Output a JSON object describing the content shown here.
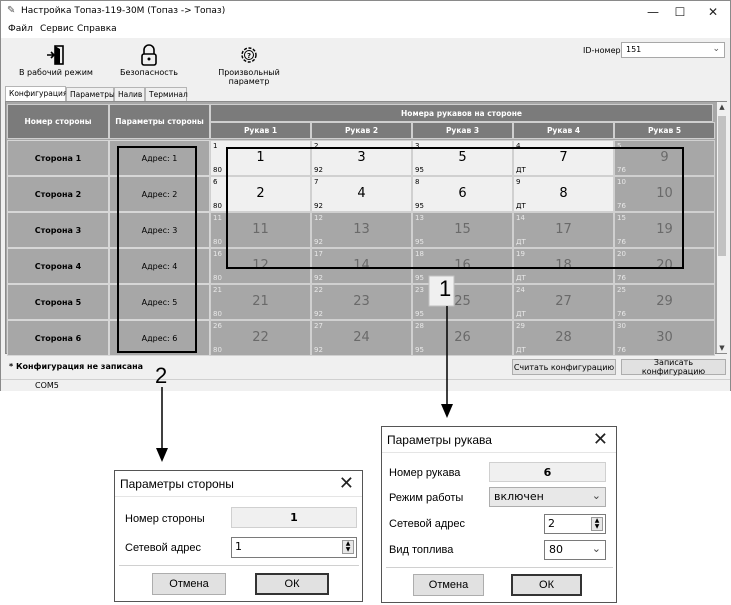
{
  "window": {
    "title": "Настройка Топаз-119-30М (Топаз -> Топаз)",
    "controls": [
      "—",
      "☐",
      "✕"
    ]
  },
  "menu": [
    "Файл",
    "Сервис",
    "Справка"
  ],
  "toolbar": {
    "work_mode": "В рабочий режим",
    "security": "Безопасность",
    "custom_param": "Произвольный параметр",
    "id_label": "ID-номер",
    "id_value": "151"
  },
  "tabs": [
    "Конфигурация",
    "Параметры",
    "Налив",
    "Терминал"
  ],
  "grid": {
    "col_side_number": "Номер стороны",
    "col_side_params": "Параметры стороны",
    "col_hoses_group": "Номера рукавов на стороне",
    "hose_headers": [
      "Рукав 1",
      "Рукав 2",
      "Рукав 3",
      "Рукав 4",
      "Рукав 5"
    ],
    "rows": [
      {
        "side": "Сторона 1",
        "addr": "Адрес: 1",
        "cells": [
          {
            "idx": "1",
            "big": "1",
            "fuel": "80"
          },
          {
            "idx": "2",
            "big": "3",
            "fuel": "92"
          },
          {
            "idx": "3",
            "big": "5",
            "fuel": "95"
          },
          {
            "idx": "4",
            "big": "7",
            "fuel": "ДТ"
          },
          {
            "idx": "5",
            "big": "9",
            "fuel": "76"
          }
        ]
      },
      {
        "side": "Сторона 2",
        "addr": "Адрес: 2",
        "cells": [
          {
            "idx": "6",
            "big": "2",
            "fuel": "80"
          },
          {
            "idx": "7",
            "big": "4",
            "fuel": "92"
          },
          {
            "idx": "8",
            "big": "6",
            "fuel": "95"
          },
          {
            "idx": "9",
            "big": "8",
            "fuel": "ДТ"
          },
          {
            "idx": "10",
            "big": "10",
            "fuel": "76"
          }
        ]
      },
      {
        "side": "Сторона 3",
        "addr": "Адрес: 3",
        "cells": [
          {
            "idx": "11",
            "big": "11",
            "fuel": "80"
          },
          {
            "idx": "12",
            "big": "13",
            "fuel": "92"
          },
          {
            "idx": "13",
            "big": "15",
            "fuel": "95"
          },
          {
            "idx": "14",
            "big": "17",
            "fuel": "ДТ"
          },
          {
            "idx": "15",
            "big": "19",
            "fuel": "76"
          }
        ]
      },
      {
        "side": "Сторона 4",
        "addr": "Адрес: 4",
        "cells": [
          {
            "idx": "16",
            "big": "12",
            "fuel": "80"
          },
          {
            "idx": "17",
            "big": "14",
            "fuel": "92"
          },
          {
            "idx": "18",
            "big": "16",
            "fuel": "95"
          },
          {
            "idx": "19",
            "big": "18",
            "fuel": "ДТ"
          },
          {
            "idx": "20",
            "big": "20",
            "fuel": "76"
          }
        ]
      },
      {
        "side": "Сторона 5",
        "addr": "Адрес: 5",
        "cells": [
          {
            "idx": "21",
            "big": "21",
            "fuel": "80"
          },
          {
            "idx": "22",
            "big": "23",
            "fuel": "92"
          },
          {
            "idx": "23",
            "big": "25",
            "fuel": "95"
          },
          {
            "idx": "24",
            "big": "27",
            "fuel": "ДТ"
          },
          {
            "idx": "25",
            "big": "29",
            "fuel": "76"
          }
        ]
      },
      {
        "side": "Сторона 6",
        "addr": "Адрес: 6",
        "cells": [
          {
            "idx": "26",
            "big": "22",
            "fuel": "80"
          },
          {
            "idx": "27",
            "big": "24",
            "fuel": "92"
          },
          {
            "idx": "28",
            "big": "26",
            "fuel": "95"
          },
          {
            "idx": "29",
            "big": "28",
            "fuel": "ДТ"
          },
          {
            "idx": "30",
            "big": "30",
            "fuel": "76"
          }
        ]
      }
    ]
  },
  "status": {
    "warning": "* Конфигурация не записана",
    "read_btn": "Считать конфигурацию",
    "write_btn": "Записать конфигурацию",
    "port": "COM5"
  },
  "callouts": {
    "one": "1",
    "two": "2"
  },
  "side_dialog": {
    "title": "Параметры стороны",
    "number_label": "Номер стороны",
    "number_value": "1",
    "addr_label": "Сетевой адрес",
    "addr_value": "1",
    "cancel": "Отмена",
    "ok": "ОК"
  },
  "hose_dialog": {
    "title": "Параметры рукава",
    "number_label": "Номер рукава",
    "number_value": "6",
    "mode_label": "Режим работы",
    "mode_value": "включен",
    "addr_label": "Сетевой адрес",
    "addr_value": "2",
    "fuel_label": "Вид топлива",
    "fuel_value": "80",
    "cancel": "Отмена",
    "ok": "ОК"
  }
}
